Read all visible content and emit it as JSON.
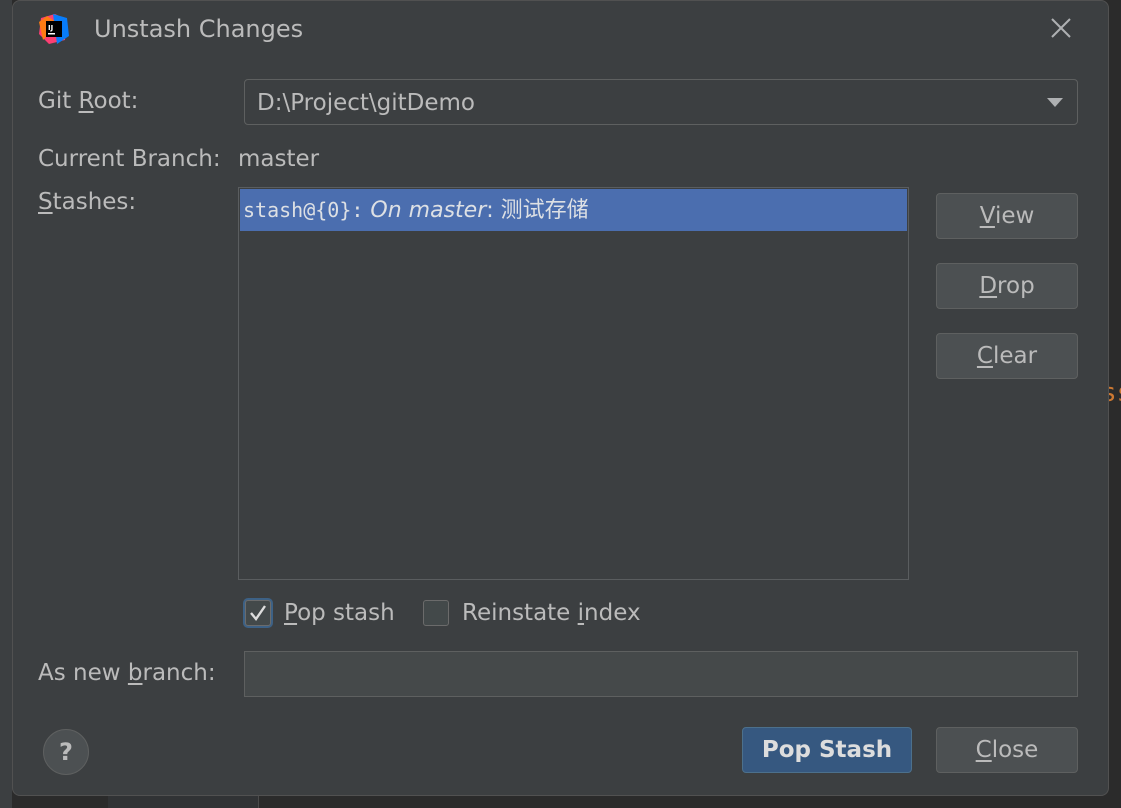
{
  "window": {
    "title": "Unstash Changes",
    "app_icon": "intellij-idea-icon"
  },
  "form": {
    "git_root": {
      "label_prefix": "Git ",
      "label_mnemonic": "R",
      "label_rest": "oot:",
      "value": "D:\\Project\\gitDemo"
    },
    "current_branch": {
      "label": "Current Branch:",
      "value": "master"
    },
    "stashes": {
      "label_mnemonic": "S",
      "label_rest": "tashes:",
      "items": [
        {
          "ref": "stash@{0}:",
          "branch": "On master",
          "sep": ":",
          "message": " 测试存储",
          "selected": true
        }
      ]
    },
    "pop_stash": {
      "mnemonic": "P",
      "rest": "op stash",
      "checked": true
    },
    "reinstate_index": {
      "prefix": "Reinstate ",
      "mnemonic": "i",
      "rest": "ndex",
      "checked": false
    },
    "new_branch": {
      "label_prefix": "As new ",
      "label_mnemonic": "b",
      "label_rest": "ranch:",
      "value": ""
    }
  },
  "side_buttons": {
    "view": {
      "mnemonic": "V",
      "rest": "iew"
    },
    "drop": {
      "mnemonic": "D",
      "rest": "rop"
    },
    "clear": {
      "mnemonic": "C",
      "rest": "lear"
    }
  },
  "footer": {
    "help": "?",
    "primary": "Pop Stash",
    "close": {
      "mnemonic": "C",
      "rest": "lose"
    }
  },
  "colors": {
    "accent": "#4b6eaf",
    "primary_button": "#365880",
    "dialog_bg": "#3c3f41",
    "background_code": "#cc7832"
  }
}
